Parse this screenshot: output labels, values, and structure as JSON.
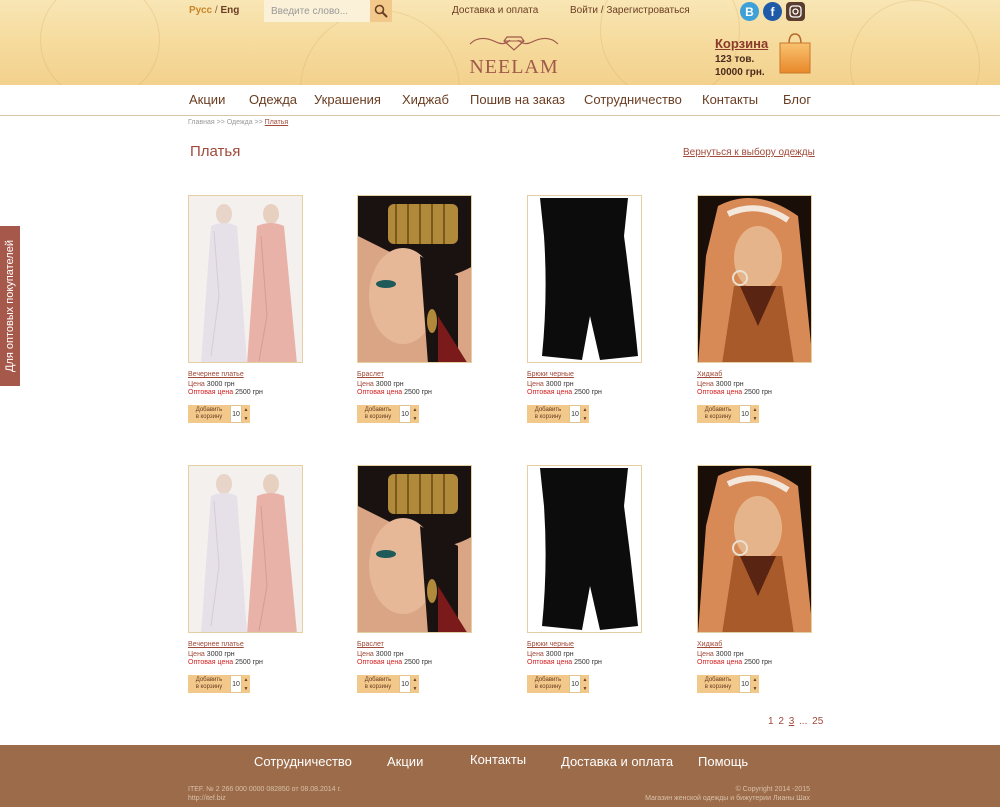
{
  "header": {
    "lang_active": "Русс",
    "lang_sep": " / ",
    "lang_other": "Eng",
    "search_placeholder": "Введите слово...",
    "delivery_link": "Доставка и оплата",
    "login_link": "Войти / Зарегистроваться",
    "social": [
      {
        "label": "B",
        "icon": "vk-icon"
      },
      {
        "label": "f",
        "icon": "facebook-icon"
      },
      {
        "label": "",
        "icon": "instagram-icon"
      }
    ],
    "logo_text": "NEELAM",
    "cart_title": "Корзина",
    "cart_count": "123 тов.",
    "cart_sum": "10000 грн."
  },
  "nav": [
    "Акции",
    "Одежда",
    "Украшения",
    "Хиджаб",
    "Пошив на заказ",
    "Сотрудничество",
    "Контакты",
    "Блог"
  ],
  "breadcrumb": {
    "home": "Главная",
    "sep": " >> ",
    "section": "Одежда",
    "current": "Платья"
  },
  "page_title": "Платья",
  "back_link": "Вернуться к выбору одежды",
  "side_tab": "Для оптовых покупателей",
  "products": [
    {
      "name": "Вечернее платье",
      "price_label": "Цена",
      "price": "3000 грн",
      "wholesale_label": "Оптовая цена",
      "wholesale": "2500 грн",
      "add_line1": "Добавить",
      "add_line2": "в корзину",
      "qty": "10",
      "image": "dress"
    },
    {
      "name": "Браслет",
      "price_label": "Цена",
      "price": "3000 грн",
      "wholesale_label": "Оптовая цена",
      "wholesale": "2500 грн",
      "add_line1": "Добавить",
      "add_line2": "в корзину",
      "qty": "10",
      "image": "bracelet"
    },
    {
      "name": "Брюки черные",
      "price_label": "Цена",
      "price": "3000 грн",
      "wholesale_label": "Оптовая цена",
      "wholesale": "2500 грн",
      "add_line1": "Добавить",
      "add_line2": "в корзину",
      "qty": "10",
      "image": "pants"
    },
    {
      "name": "Хиджаб",
      "price_label": "Цена",
      "price": "3000 грн",
      "wholesale_label": "Оптовая цена",
      "wholesale": "2500 грн",
      "add_line1": "Добавить",
      "add_line2": "в корзину",
      "qty": "10",
      "image": "hijab"
    },
    {
      "name": "Вечернее платье",
      "price_label": "Цена",
      "price": "3000 грн",
      "wholesale_label": "Оптовая цена",
      "wholesale": "2500 грн",
      "add_line1": "Добавить",
      "add_line2": "в корзину",
      "qty": "10",
      "image": "dress"
    },
    {
      "name": "Браслет",
      "price_label": "Цена",
      "price": "3000 грн",
      "wholesale_label": "Оптовая цена",
      "wholesale": "2500 грн",
      "add_line1": "Добавить",
      "add_line2": "в корзину",
      "qty": "10",
      "image": "bracelet"
    },
    {
      "name": "Брюки черные",
      "price_label": "Цена",
      "price": "3000 грн",
      "wholesale_label": "Оптовая цена",
      "wholesale": "2500 грн",
      "add_line1": "Добавить",
      "add_line2": "в корзину",
      "qty": "10",
      "image": "pants"
    },
    {
      "name": "Хиджаб",
      "price_label": "Цена",
      "price": "3000 грн",
      "wholesale_label": "Оптовая цена",
      "wholesale": "2500 грн",
      "add_line1": "Добавить",
      "add_line2": "в корзину",
      "qty": "10",
      "image": "hijab"
    }
  ],
  "pagination": {
    "pages": [
      "1",
      "2",
      "3"
    ],
    "current": "3",
    "ellipsis": "...",
    "last": "25"
  },
  "footer": {
    "links": [
      "Сотрудничество",
      "Акции",
      "Контакты",
      "Доставка и оплата",
      "Помощь"
    ],
    "legal_left_1": "ITEF. № 2 266 000 0000 082850 от 08.08.2014 г.",
    "legal_left_2": "http://itef.biz",
    "legal_right_1": "© Copyright 2014 -2015",
    "legal_right_2": "Магазин женской одежды и бижутерии Лианы Шах"
  },
  "colors": {
    "accent": "#a04a3a",
    "gold": "#f2c98a",
    "footer": "#9b6b4a",
    "side_tab": "#a6584a"
  }
}
